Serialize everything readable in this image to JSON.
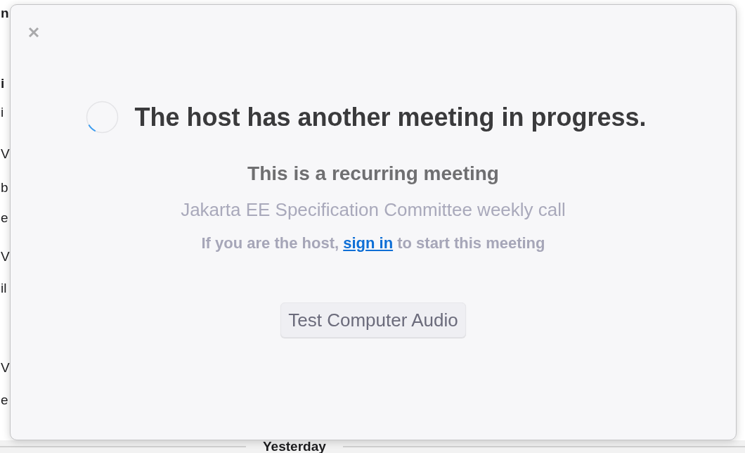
{
  "background": {
    "fragments": [
      {
        "text": "n",
        "bold": true
      },
      {
        "text": "i",
        "bold": true
      },
      {
        "text": "i",
        "bold": false
      },
      {
        "text": "V",
        "bold": false
      },
      {
        "text": "b",
        "bold": false
      },
      {
        "text": "e",
        "bold": false
      },
      {
        "text": "V",
        "bold": false
      },
      {
        "text": "il",
        "bold": false
      },
      {
        "text": "V",
        "bold": false
      },
      {
        "text": "e",
        "bold": false
      }
    ],
    "date_divider": "Yesterday"
  },
  "dialog": {
    "title": "The host has another meeting in progress.",
    "subtitle": "This is a recurring meeting",
    "meeting_name": "Jakarta EE Specification Committee weekly call",
    "host_prompt": {
      "before": "If you are the host,",
      "link": "sign in",
      "after": "to start this meeting"
    },
    "buttons": [
      {
        "label": "Test Computer Audio"
      }
    ]
  }
}
